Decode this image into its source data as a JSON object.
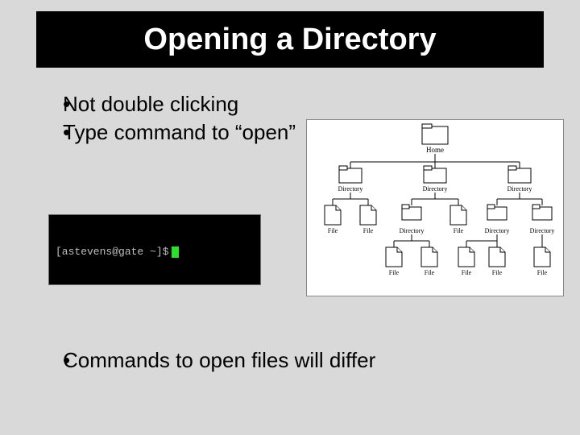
{
  "title": "Opening a Directory",
  "bullets_top": [
    "Not double clicking",
    "Type command to “open”"
  ],
  "bullets_bottom": [
    "Commands to open files will differ"
  ],
  "terminal": {
    "prompt": "[astevens@gate ~]$"
  },
  "tree": {
    "root_label": "Home",
    "mid_labels": [
      "Directory",
      "Directory",
      "Directory"
    ],
    "row3_labels": [
      "File",
      "File",
      "Directory",
      "File",
      "Directory",
      "Directory"
    ],
    "row4_labels": [
      "File",
      "File",
      "File",
      "File",
      "File"
    ]
  }
}
